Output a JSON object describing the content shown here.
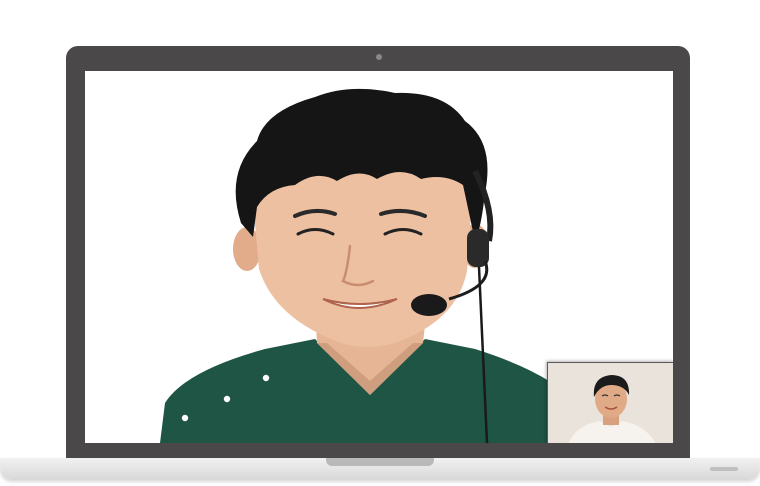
{
  "screen": {
    "remote_participant": "person-wearing-headset",
    "self_view": "self-view-person"
  },
  "colors": {
    "bezel": "#4a4849",
    "scrubs": "#1f5545",
    "self_view_bg": "#e9e3dc"
  },
  "icons": [
    "webcam-icon",
    "headset-microphone-icon"
  ]
}
